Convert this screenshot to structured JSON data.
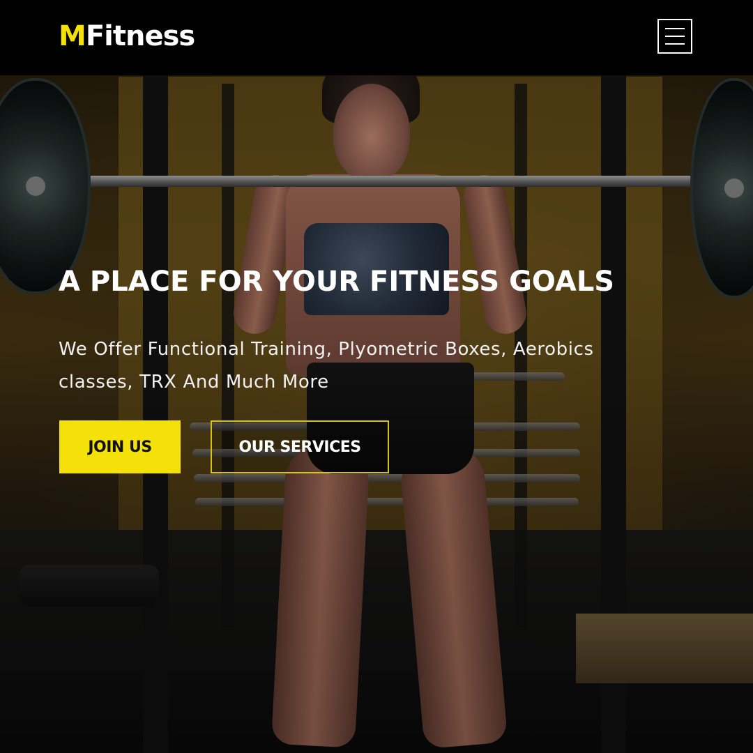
{
  "brand": {
    "logo_initial": "M",
    "logo_rest": "Fitness",
    "accent_color": "#f4e10a"
  },
  "nav": {
    "menu_icon": "hamburger-menu-icon"
  },
  "hero": {
    "title": "A PLACE FOR YOUR FITNESS GOALS",
    "subtitle_line1": "We Offer Functional Training, Plyometric Boxes, Aerobics",
    "subtitle_line2": "classes, TRX And Much More",
    "primary_button": "JOIN US",
    "secondary_button": "OUR SERVICES"
  }
}
